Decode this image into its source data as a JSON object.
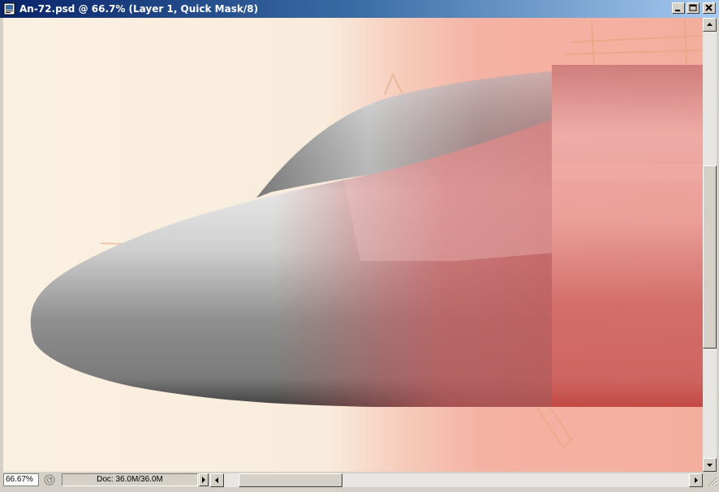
{
  "window": {
    "title": "An-72.psd @ 66.7% (Layer 1, Quick Mask/8)",
    "buttons": [
      "minimize",
      "maximize",
      "close"
    ]
  },
  "canvas": {
    "document_name": "An-72.psd",
    "zoom": "66.7%",
    "layer": "Layer 1",
    "mode": "Quick Mask/8",
    "colors": {
      "background": "#faf0e2",
      "mask_overlay": "#f2a59b",
      "sketch_lines": "#d9a070",
      "fuselage_grey": "#a8a8a8",
      "fuselage_red": "#c0504f"
    }
  },
  "statusbar": {
    "zoom_value": "66.67%",
    "doc_info": "Doc: 36.0M/36.0M"
  },
  "icons": {
    "doc": "photoshop-document-icon",
    "navigator": "navigator-icon",
    "minimize": "minimize-icon",
    "maximize": "maximize-icon",
    "close": "close-icon"
  },
  "scrollbars": {
    "vertical_position": 0.55,
    "horizontal_position": 0.04
  }
}
